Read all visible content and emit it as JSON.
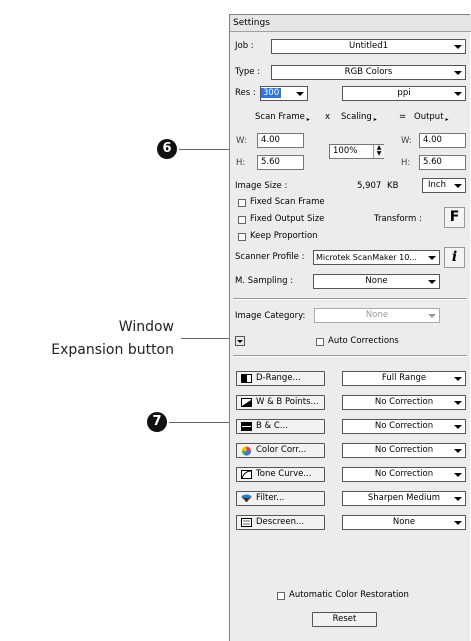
{
  "window_title": "Settings",
  "job": {
    "label": "Job :",
    "value": "Untitled1"
  },
  "type": {
    "label": "Type :",
    "value": "RGB Colors"
  },
  "res": {
    "label": "Res :",
    "value": "300",
    "unit": "ppi"
  },
  "header": {
    "scan_frame": "Scan Frame",
    "x": "x",
    "scaling": "Scaling",
    "eq": "=",
    "output": "Output"
  },
  "scan_frame": {
    "w_label": "W:",
    "w": "4.00",
    "h_label": "H:",
    "h": "5.60"
  },
  "scaling": {
    "value": "100%"
  },
  "output": {
    "w_label": "W:",
    "w": "4.00",
    "h_label": "H:",
    "h": "5.60"
  },
  "image_size": {
    "label": "Image Size :",
    "value": "5,907",
    "unit": "KB",
    "measure_unit": "Inch"
  },
  "checkboxes": {
    "fixed_scan_frame": "Fixed Scan Frame",
    "fixed_output_size": "Fixed Output Size",
    "keep_proportion": "Keep Proportion"
  },
  "transform": {
    "label": "Transform :",
    "icon_text": "F"
  },
  "scanner_profile": {
    "label": "Scanner Profile :",
    "value": "Microtek ScanMaker 10...",
    "info_text": "i"
  },
  "m_sampling": {
    "label": "M. Sampling :",
    "value": "None"
  },
  "image_category": {
    "label": "Image Category:",
    "value": "None"
  },
  "auto_corrections": "Auto Corrections",
  "tools": [
    {
      "button": "D-Range...",
      "value": "Full Range"
    },
    {
      "button": "W & B Points...",
      "value": "No Correction"
    },
    {
      "button": "B & C...",
      "value": "No Correction"
    },
    {
      "button": "Color Corr...",
      "value": "No Correction"
    },
    {
      "button": "Tone Curve...",
      "value": "No Correction"
    },
    {
      "button": "Filter...",
      "value": "Sharpen Medium"
    },
    {
      "button": "Descreen...",
      "value": "None"
    }
  ],
  "automatic_color_restoration": "Automatic Color Restoration",
  "reset": "Reset",
  "annotations": {
    "badge6": "6",
    "badge7": "7",
    "window_line1": "Window",
    "window_line2": "Expansion button"
  },
  "colors": {
    "panel_bg": "#ececec",
    "res_highlight": "#3375d7",
    "badge": "#111111"
  }
}
